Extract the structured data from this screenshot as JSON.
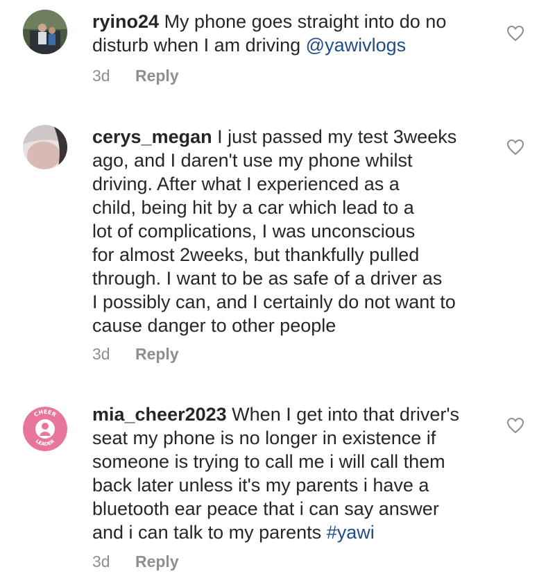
{
  "comments": [
    {
      "username": "ryino24",
      "lines": [
        "My phone goes straight into do no",
        "disturb when I am driving"
      ],
      "mention": "@yawivlogs",
      "time": "3d",
      "reply_label": "Reply",
      "avatar_icon": "user-photo-avatar"
    },
    {
      "username": "cerys_megan",
      "lines": [
        "I just passed my test 3weeks",
        "ago, and I daren't use my phone whilst",
        "driving.  After what I experienced as a",
        "child, being hit by a car which lead to a",
        "lot of complications, I was unconscious",
        "for almost 2weeks, but thankfully pulled",
        "through.  I want to be as safe of a driver as",
        "I possibly can, and I certainly do not want to",
        "cause danger to other people"
      ],
      "time": "3d",
      "reply_label": "Reply",
      "avatar_icon": "user-photo-avatar"
    },
    {
      "username": "mia_cheer2023",
      "lines": [
        "When I get into that driver's",
        "seat my phone is no longer in existence if",
        "someone is trying to call me i will call them",
        "back later unless it's my parents i have a",
        "bluetooth ear peace that i can say answer",
        "and i can talk to my parents"
      ],
      "hashtag": "#yawi",
      "time": "3d",
      "reply_label": "Reply",
      "avatar_top_text": "CHEER",
      "avatar_bottom_text": "LEADER",
      "avatar_icon": "cheer-leader-logo-avatar"
    }
  ],
  "icons": {
    "like": "heart-outline-icon"
  },
  "colors": {
    "link": "#1e4d86",
    "meta": "#8e8e8e",
    "text": "#262626",
    "cheer_pink": "#e8759a"
  }
}
